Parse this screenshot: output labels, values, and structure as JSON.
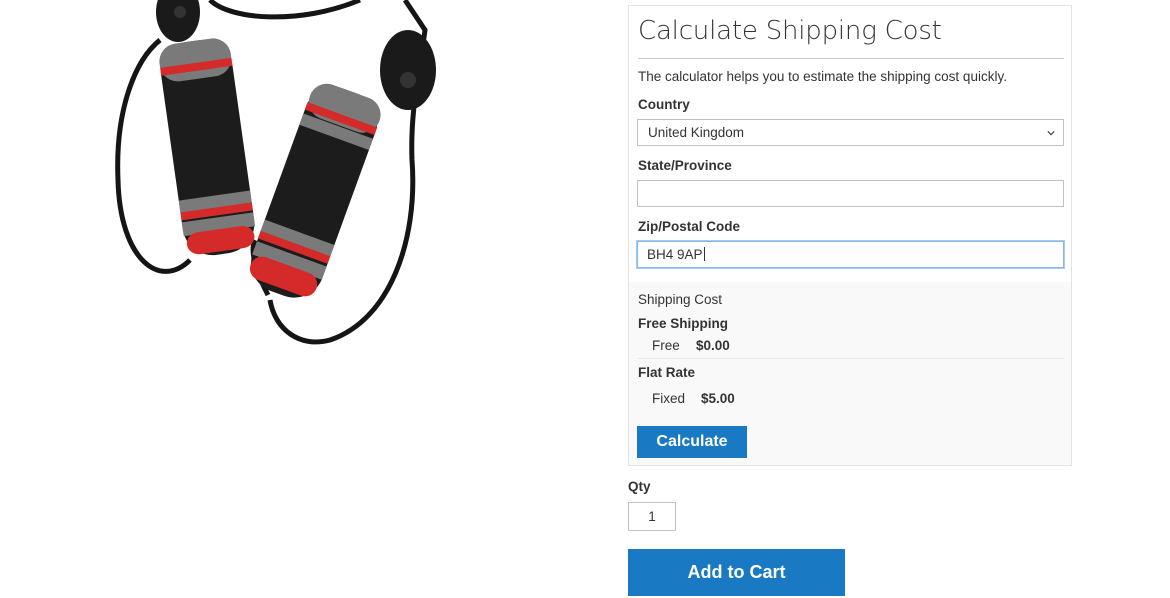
{
  "shipping_calculator": {
    "title": "Calculate Shipping Cost",
    "description": "The calculator helps you to estimate the shipping cost quickly.",
    "country_label": "Country",
    "country_value": "United Kingdom",
    "state_label": "State/Province",
    "state_value": "",
    "zip_label": "Zip/Postal Code",
    "zip_value": "BH4 9AP",
    "rates_heading": "Shipping Cost",
    "rates": [
      {
        "method": "Free Shipping",
        "label": "Free",
        "price": "$0.00"
      },
      {
        "method": "Flat Rate",
        "label": "Fixed",
        "price": "$5.00"
      }
    ],
    "calculate_label": "Calculate"
  },
  "purchase": {
    "qty_label": "Qty",
    "qty_value": "1",
    "add_to_cart_label": "Add to Cart"
  },
  "product_image": {
    "subject": "jump rope with black foam handles and red and gray rings"
  },
  "colors": {
    "primary_button": "#1979c3",
    "panel_background": "#f9f9f9",
    "input_border": "#c2c2c2",
    "focus_border": "#86b7e8"
  },
  "icons": {
    "country_dropdown": "chevron-down-icon"
  }
}
